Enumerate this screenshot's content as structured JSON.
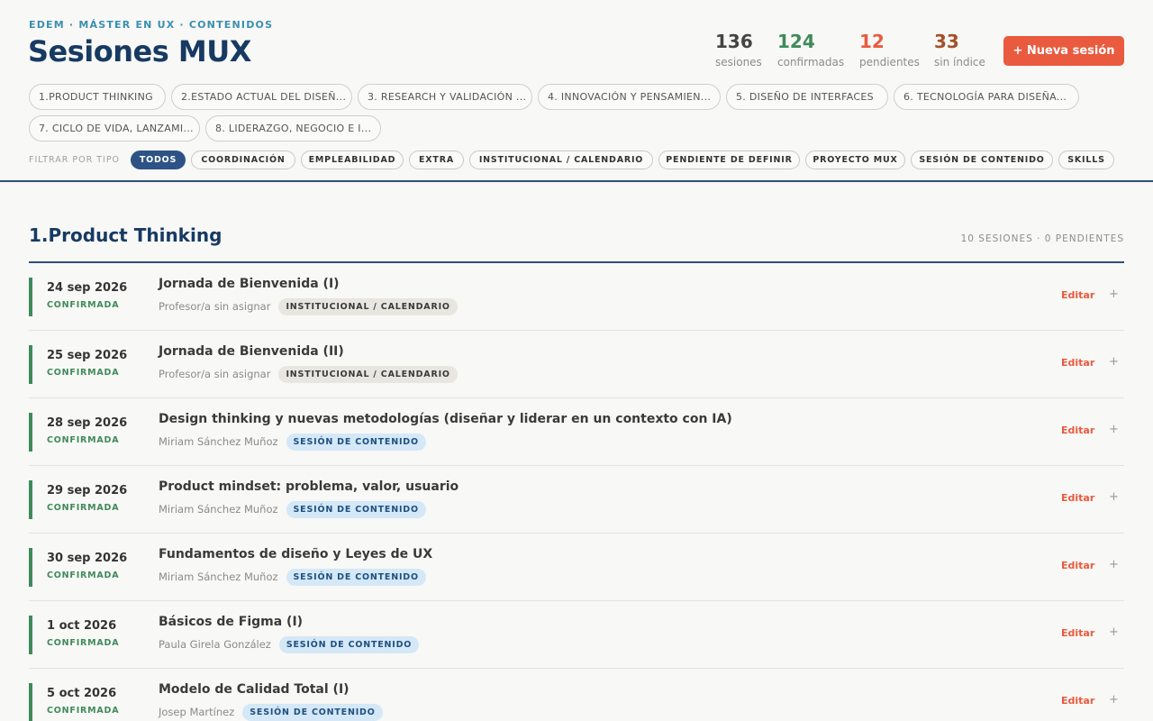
{
  "header": {
    "breadcrumb": "EDEM · MÁSTER EN UX · CONTENIDOS",
    "title": "Sesiones MUX",
    "new_button": "+ Nueva sesión"
  },
  "stats": [
    {
      "value": "136",
      "label": "sesiones",
      "color": "#444444"
    },
    {
      "value": "124",
      "label": "confirmadas",
      "color": "#3f8a5b"
    },
    {
      "value": "12",
      "label": "pendientes",
      "color": "#e95a3f"
    },
    {
      "value": "33",
      "label": "sin índice",
      "color": "#a4502a"
    }
  ],
  "modules": [
    "1.PRODUCT THINKING",
    "2.ESTADO ACTUAL DEL DISEÑ...",
    "3. RESEARCH Y VALIDACIÓN ...",
    "4. INNOVACIÓN Y PENSAMIEN...",
    "5. DISEÑO DE INTERFACES",
    "6. TECNOLOGÍA PARA DISEÑA...",
    "7. CICLO DE VIDA, LANZAMI...",
    "8. LIDERAZGO, NEGOCIO E I..."
  ],
  "filters": {
    "label": "FILTRAR POR TIPO",
    "items": [
      "TODOS",
      "COORDINACIÓN",
      "EMPLEABILIDAD",
      "EXTRA",
      "INSTITUCIONAL / CALENDARIO",
      "PENDIENTE DE DEFINIR",
      "PROYECTO MUX",
      "SESIÓN DE CONTENIDO",
      "SKILLS"
    ],
    "active": "TODOS"
  },
  "section": {
    "title": "1.Product Thinking",
    "meta": "10 SESIONES · 0 PENDIENTES"
  },
  "row_actions": {
    "edit": "Editar",
    "add": "+"
  },
  "sessions": [
    {
      "date": "24 sep 2026",
      "status": "CONFIRMADA",
      "title": "Jornada de Bienvenida (I)",
      "professor": "Profesor/a sin asignar",
      "tag": "INSTITUCIONAL / CALENDARIO",
      "tag_kind": "inst"
    },
    {
      "date": "25 sep 2026",
      "status": "CONFIRMADA",
      "title": "Jornada de Bienvenida (II)",
      "professor": "Profesor/a sin asignar",
      "tag": "INSTITUCIONAL / CALENDARIO",
      "tag_kind": "inst"
    },
    {
      "date": "28 sep 2026",
      "status": "CONFIRMADA",
      "title": "Design thinking y nuevas metodologías (diseñar y liderar en un contexto con IA)",
      "professor": "Miriam Sánchez Muñoz",
      "tag": "SESIÓN DE CONTENIDO",
      "tag_kind": "cont"
    },
    {
      "date": "29 sep 2026",
      "status": "CONFIRMADA",
      "title": "Product mindset: problema, valor, usuario",
      "professor": "Miriam Sánchez Muñoz",
      "tag": "SESIÓN DE CONTENIDO",
      "tag_kind": "cont"
    },
    {
      "date": "30 sep 2026",
      "status": "CONFIRMADA",
      "title": "Fundamentos de diseño y Leyes de UX",
      "professor": "Miriam Sánchez Muñoz",
      "tag": "SESIÓN DE CONTENIDO",
      "tag_kind": "cont"
    },
    {
      "date": "1 oct 2026",
      "status": "CONFIRMADA",
      "title": "Básicos de Figma (I)",
      "professor": "Paula Girela González",
      "tag": "SESIÓN DE CONTENIDO",
      "tag_kind": "cont"
    },
    {
      "date": "5 oct 2026",
      "status": "CONFIRMADA",
      "title": "Modelo de Calidad Total (I)",
      "professor": "Josep Martínez",
      "tag": "SESIÓN DE CONTENIDO",
      "tag_kind": "cont"
    }
  ]
}
